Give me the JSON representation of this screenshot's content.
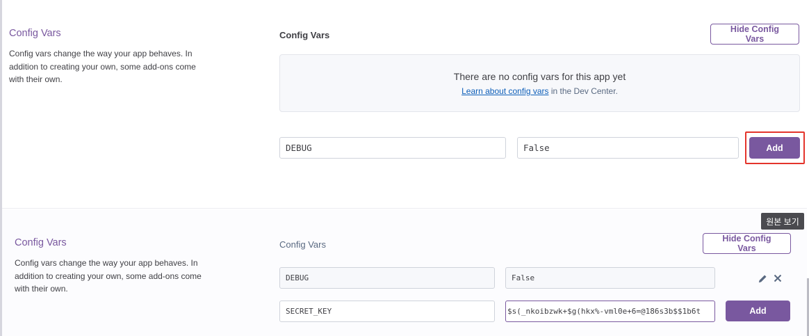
{
  "top": {
    "section_title": "Config Vars",
    "section_desc": "Config vars change the way your app behaves. In addition to creating your own, some add-ons come with their own.",
    "panel_title": "Config Vars",
    "hide_button": "Hide Config Vars",
    "empty_message": "There are no config vars for this app yet",
    "learn_link": "Learn about config vars",
    "learn_suffix": " in the Dev Center.",
    "key_value": "DEBUG",
    "value_value": "False",
    "add_button": "Add"
  },
  "bottom": {
    "section_title": "Config Vars",
    "section_desc": "Config vars change the way your app behaves. In addition to creating your own, some add-ons come with their own.",
    "panel_title": "Config Vars",
    "hide_button": "Hide Config Vars",
    "row1_key": "DEBUG",
    "row1_value": "False",
    "new_key": "SECRET_KEY",
    "new_value": "$s(_nkoibzwk+$g(hkx%-vml0e+6=@186s3b$$1b6t",
    "add_button": "Add"
  },
  "tooltip": "원본 보기",
  "icons": {
    "edit": "pencil-icon",
    "delete": "close-icon"
  },
  "colors": {
    "accent": "#79589f",
    "highlight": "#e4342b",
    "link": "#0e5fb9"
  }
}
